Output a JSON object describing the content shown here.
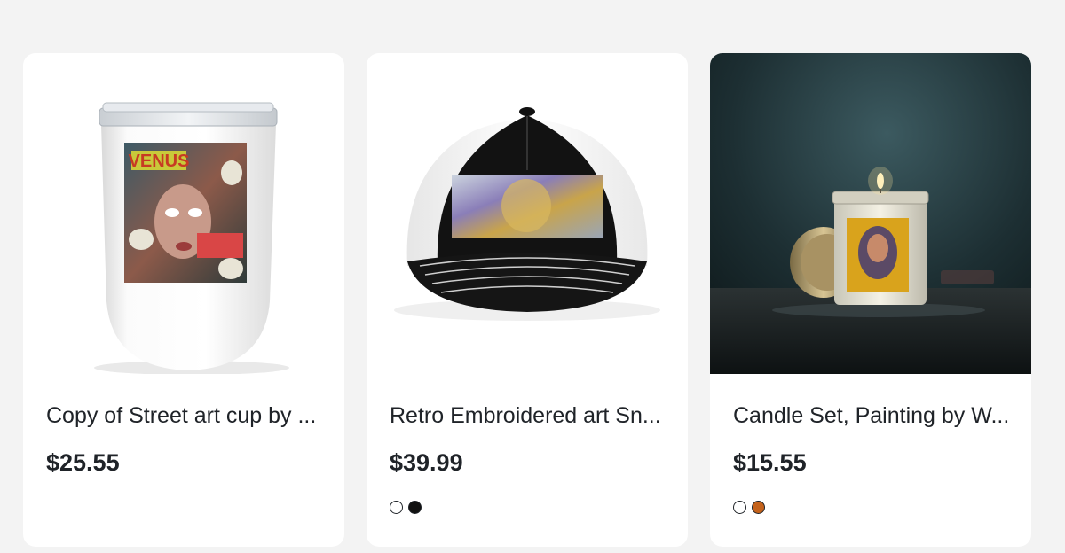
{
  "products": [
    {
      "title": "Copy of Street art cup by ...",
      "price": "$25.55",
      "image_art_text": "VENUS",
      "swatches": []
    },
    {
      "title": "Retro Embroidered art Sn...",
      "price": "$39.99",
      "swatches": [
        {
          "name": "white",
          "color": "#ffffff"
        },
        {
          "name": "black",
          "color": "#111111"
        }
      ]
    },
    {
      "title": "Candle Set, Painting by W...",
      "price": "$15.55",
      "swatches": [
        {
          "name": "white",
          "color": "#ffffff"
        },
        {
          "name": "amber",
          "color": "#c4621b"
        }
      ]
    }
  ]
}
